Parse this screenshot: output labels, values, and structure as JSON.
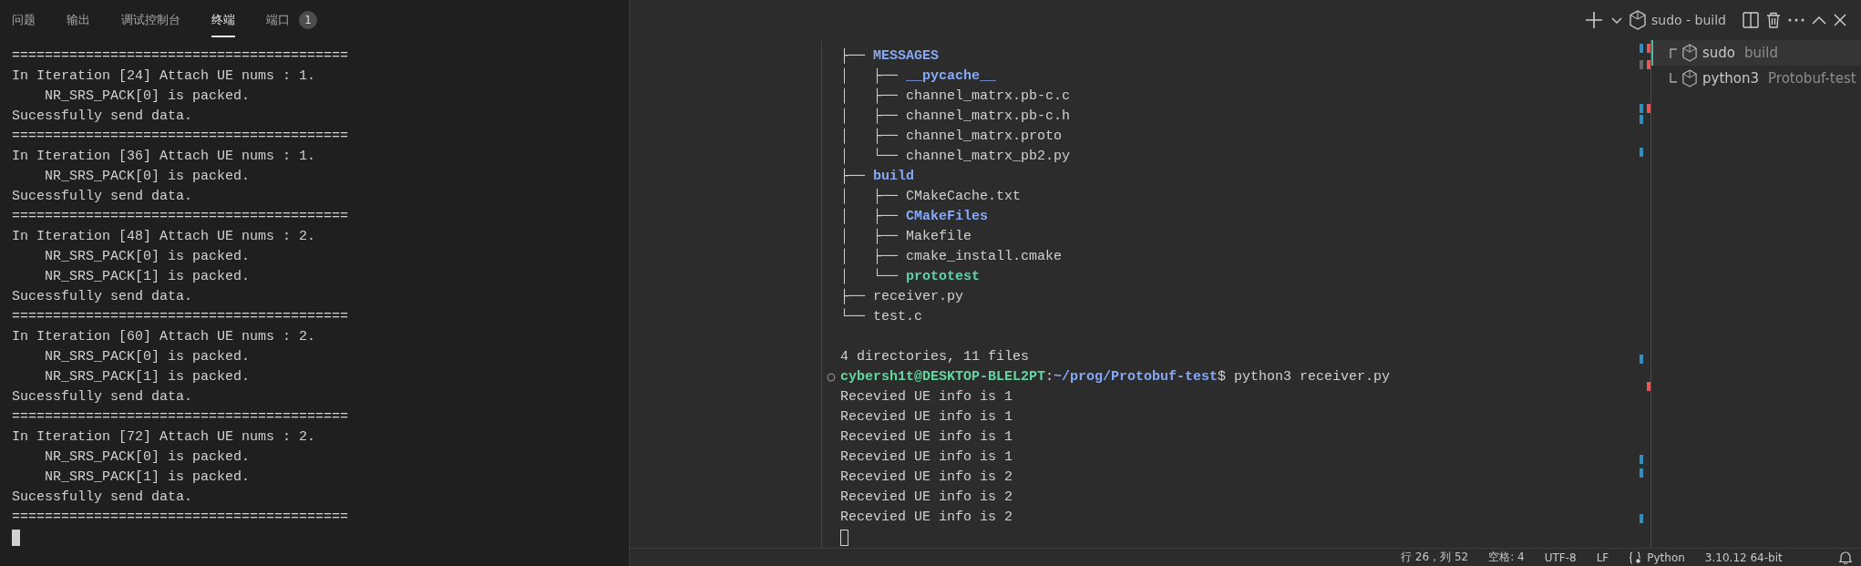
{
  "left_panel": {
    "tabs": [
      {
        "label": "问题",
        "selected": false
      },
      {
        "label": "输出",
        "selected": false
      },
      {
        "label": "调试控制台",
        "selected": false
      },
      {
        "label": "终端",
        "selected": true
      },
      {
        "label": "端口",
        "selected": false,
        "badge": "1"
      }
    ],
    "lines": [
      "=========================================",
      "In Iteration [24] Attach UE nums : 1.",
      "    NR_SRS_PACK[0] is packed.",
      "Sucessfully send data.",
      "=========================================",
      "In Iteration [36] Attach UE nums : 1.",
      "    NR_SRS_PACK[0] is packed.",
      "Sucessfully send data.",
      "=========================================",
      "In Iteration [48] Attach UE nums : 2.",
      "    NR_SRS_PACK[0] is packed.",
      "    NR_SRS_PACK[1] is packed.",
      "Sucessfully send data.",
      "=========================================",
      "In Iteration [60] Attach UE nums : 2.",
      "    NR_SRS_PACK[0] is packed.",
      "    NR_SRS_PACK[1] is packed.",
      "Sucessfully send data.",
      "=========================================",
      "In Iteration [72] Attach UE nums : 2.",
      "    NR_SRS_PACK[0] is packed.",
      "    NR_SRS_PACK[1] is packed.",
      "Sucessfully send data.",
      "========================================="
    ]
  },
  "terminal_header": {
    "active_terminal": "sudo - build"
  },
  "terminal": {
    "tree": [
      {
        "prefix": "├── ",
        "name": "MESSAGES",
        "kind": "dir"
      },
      {
        "prefix": "│   ├── ",
        "name": "__pycache__",
        "kind": "dir"
      },
      {
        "prefix": "│   ├── ",
        "name": "channel_matrx.pb-c.c",
        "kind": "file"
      },
      {
        "prefix": "│   ├── ",
        "name": "channel_matrx.pb-c.h",
        "kind": "file"
      },
      {
        "prefix": "│   ├── ",
        "name": "channel_matrx.proto",
        "kind": "file"
      },
      {
        "prefix": "│   └── ",
        "name": "channel_matrx_pb2.py",
        "kind": "file"
      },
      {
        "prefix": "├── ",
        "name": "build",
        "kind": "dir"
      },
      {
        "prefix": "│   ├── ",
        "name": "CMakeCache.txt",
        "kind": "file"
      },
      {
        "prefix": "│   ├── ",
        "name": "CMakeFiles",
        "kind": "dir"
      },
      {
        "prefix": "│   ├── ",
        "name": "Makefile",
        "kind": "file"
      },
      {
        "prefix": "│   ├── ",
        "name": "cmake_install.cmake",
        "kind": "file"
      },
      {
        "prefix": "│   └── ",
        "name": "prototest",
        "kind": "exec"
      },
      {
        "prefix": "├── ",
        "name": "receiver.py",
        "kind": "file"
      },
      {
        "prefix": "└── ",
        "name": "test.c",
        "kind": "file"
      }
    ],
    "summary": "4 directories, 11 files",
    "prompt": {
      "user": "cybersh1t@DESKTOP-BLEL2PT",
      "separator": ":",
      "path": "~/prog/Protobuf-test",
      "command": "$ python3 receiver.py"
    },
    "output": [
      "Recevied UE info is 1",
      "Recevied UE info is 1",
      "Recevied UE info is 1",
      "Recevied UE info is 1",
      "Recevied UE info is 2",
      "Recevied UE info is 2",
      "Recevied UE info is 2"
    ]
  },
  "terminal_list": [
    {
      "name": "sudo",
      "detail": "build",
      "selected": true
    },
    {
      "name": "python3",
      "detail": "Protobuf-test",
      "selected": false
    }
  ],
  "status_bar": {
    "position": "行 26，列 52",
    "indentation": "空格: 4",
    "encoding": "UTF-8",
    "line_ending": "LF",
    "language": "Python",
    "interpreter": "3.10.12 64-bit"
  }
}
